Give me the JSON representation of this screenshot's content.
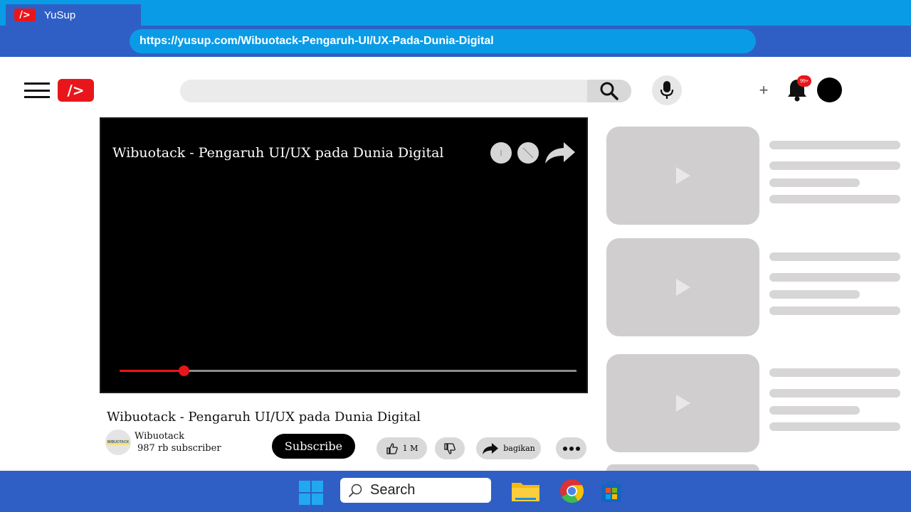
{
  "browser": {
    "tab_title": "YuSup",
    "tab_logo": "/>",
    "url": "https://yusup.com/Wibuotack-Pengaruh-UI/UX-Pada-Dunia-Digital"
  },
  "header": {
    "logo": "/>",
    "search_placeholder": "",
    "notification_badge": "99+",
    "create_icon": "+"
  },
  "player": {
    "title": "Wibuotack - Pengaruh UI/UX pada Dunia Digital",
    "progress": 0.14
  },
  "video": {
    "title": "Wibuotack - Pengaruh UI/UX pada Dunia Digital",
    "channel_name": "Wibuotack",
    "channel_avatar_text": "WIBUOTACK",
    "subscribers": "987 rb subscriber",
    "subscribe_label": "Subscribe",
    "like_count": "1 M",
    "share_label": "bagikan"
  },
  "recommendations": [
    {
      "id": 1
    },
    {
      "id": 2
    },
    {
      "id": 3
    }
  ],
  "taskbar": {
    "search_label": "Search"
  },
  "colors": {
    "brand_red": "#e8161b",
    "chrome_blue": "#2f5fc4",
    "title_blue": "#0a9be6"
  }
}
